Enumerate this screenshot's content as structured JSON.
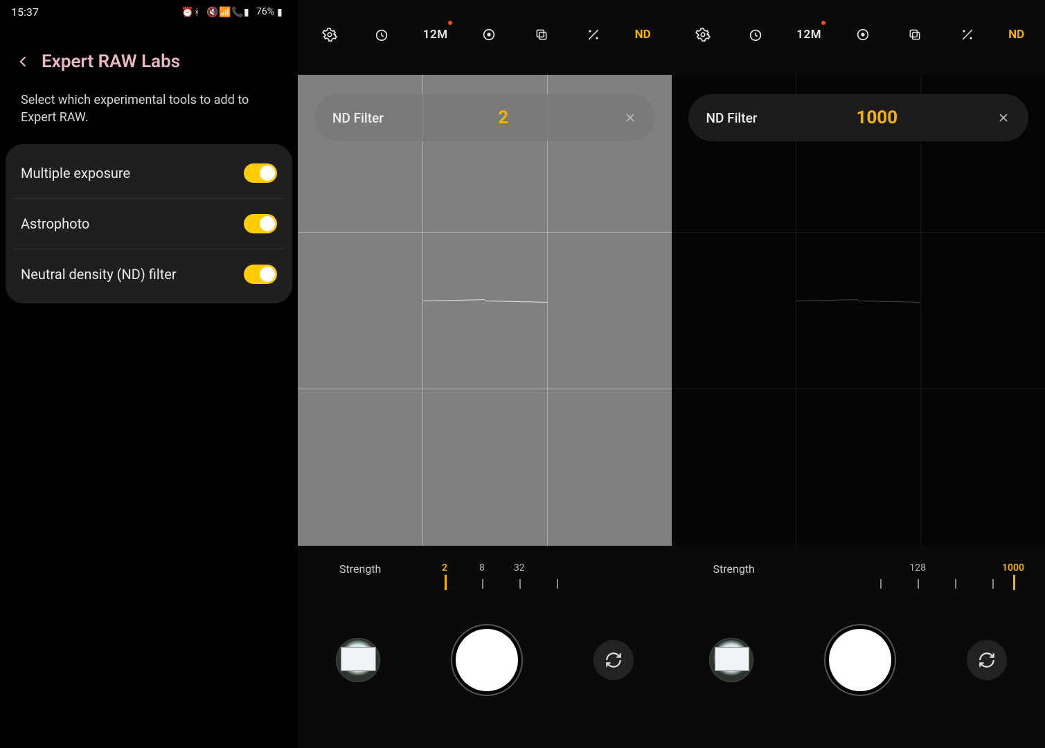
{
  "statusbar": {
    "time": "15:37",
    "battery_pct": "76%",
    "icons": [
      "alarm",
      "bluetooth",
      "mute",
      "wifi",
      "volte",
      "signal",
      "battery"
    ]
  },
  "settings": {
    "title": "Expert RAW Labs",
    "description": "Select which experimental tools to add to Expert RAW.",
    "items": [
      {
        "label": "Multiple exposure",
        "on": true
      },
      {
        "label": "Astrophoto",
        "on": true
      },
      {
        "label": "Neutral density (ND) filter",
        "on": true
      }
    ]
  },
  "camera_common": {
    "res_label": "12M",
    "nd_mode_label": "ND",
    "nd_chip_label": "ND Filter",
    "strength_label": "Strength"
  },
  "camera_left": {
    "nd_value": "2",
    "slider": {
      "current": "2",
      "labels": [
        "2",
        "8",
        "32"
      ],
      "tick_positions_pct": [
        4,
        22,
        40,
        58
      ],
      "label_positions_pct": [
        4,
        22,
        40
      ],
      "current_index": 0
    }
  },
  "camera_right": {
    "nd_value": "1000",
    "slider": {
      "current": "1000",
      "labels": [
        "128",
        "1000"
      ],
      "tick_positions_pct": [
        34,
        52,
        70,
        88,
        98
      ],
      "label_positions_pct": [
        52,
        98
      ],
      "current_index": 4
    }
  }
}
